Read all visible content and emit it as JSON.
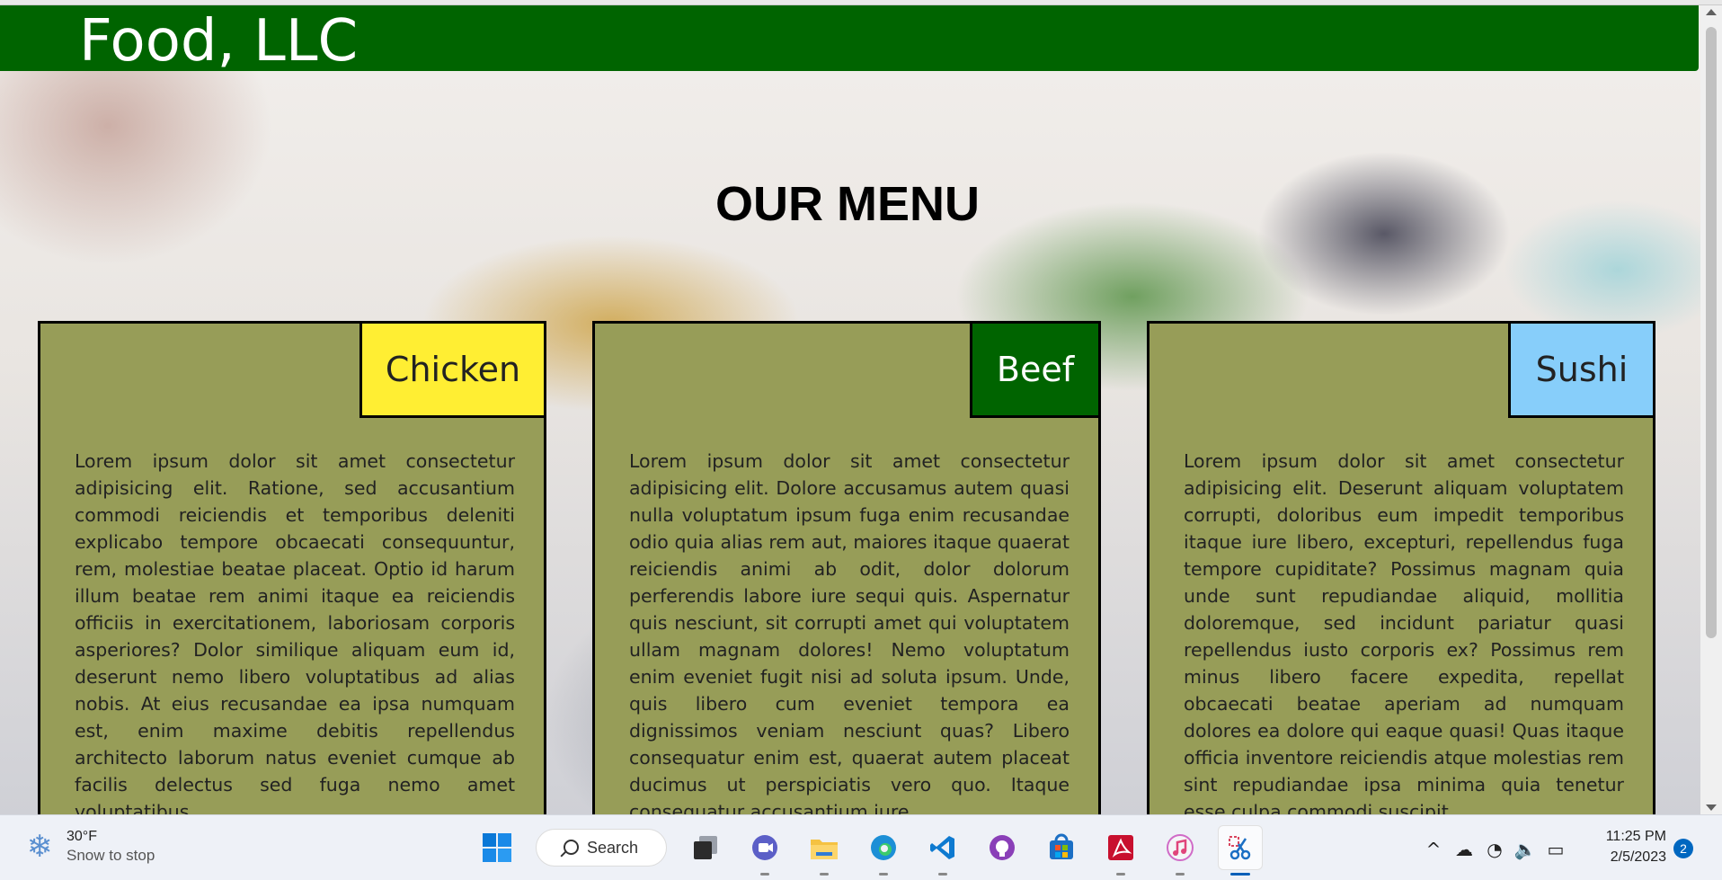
{
  "site": {
    "title": "Food, LLC"
  },
  "menu": {
    "heading": "OUR MENU",
    "cards": [
      {
        "tag": "Chicken",
        "tag_bg": "#ffee33",
        "tag_color": "#222222",
        "text": "Lorem ipsum dolor sit amet consectetur adipisicing elit. Ratione, sed accusantium commodi reiciendis et temporibus deleniti explicabo tempore obcaecati consequuntur, rem, molestiae beatae placeat. Optio id harum illum beatae rem animi itaque ea reiciendis officiis in exercitationem, laboriosam corporis asperiores? Dolor similique aliquam eum id, deserunt nemo libero voluptatibus ad alias nobis. At eius recusandae ea ipsa numquam est, enim maxime debitis repellendus architecto laborum natus eveniet cumque ab facilis delectus sed fuga nemo amet voluptatibus"
      },
      {
        "tag": "Beef",
        "tag_bg": "#006400",
        "tag_color": "#ffffff",
        "text": "Lorem ipsum dolor sit amet consectetur adipisicing elit. Dolore accusamus autem quasi nulla voluptatum ipsum fuga enim recusandae odio quia alias rem aut, maiores itaque quaerat reiciendis animi ab odit, dolor dolorum perferendis labore iure sequi quis. Aspernatur quis nesciunt, sit corrupti amet qui voluptatem ullam magnam dolores! Nemo voluptatum enim eveniet fugit nisi ad soluta ipsum. Unde, quis libero cum eveniet tempora ea dignissimos veniam nesciunt quas? Libero consequatur enim est, quaerat autem placeat ducimus ut perspiciatis vero quo. Itaque consequatur accusantium iure"
      },
      {
        "tag": "Sushi",
        "tag_bg": "#87cefa",
        "tag_color": "#222222",
        "text": "Lorem ipsum dolor sit amet consectetur adipisicing elit. Deserunt aliquam voluptatem corrupti, doloribus eum impedit temporibus itaque iure libero, excepturi, repellendus fuga tempore cupiditate? Possimus magnam quia unde sunt repudiandae aliquid, mollitia doloremque, sed incidunt pariatur quasi repellendus iusto corporis ex? Possimus rem minus libero facere expedita, repellat obcaecati beatae aperiam ad numquam dolores ea dolore qui eaque quasi! Quas itaque officia inventore reiciendis atque molestias rem sint repudiandae ipsa minima quia tenetur esse culpa commodi suscipit"
      }
    ]
  },
  "taskbar": {
    "weather": {
      "temp": "30°F",
      "desc": "Snow to stop",
      "icon": "snowflake-icon"
    },
    "search_label": "Search",
    "apps": [
      "windows-start-icon",
      "search",
      "task-view-icon",
      "teams-icon",
      "file-explorer-icon",
      "edge-icon",
      "vscode-icon",
      "github-icon",
      "store-icon",
      "acrobat-icon",
      "itunes-icon",
      "snipping-tool-icon"
    ],
    "clock": {
      "time": "11:25 PM",
      "date": "2/5/2023"
    },
    "notification_count": "2"
  }
}
